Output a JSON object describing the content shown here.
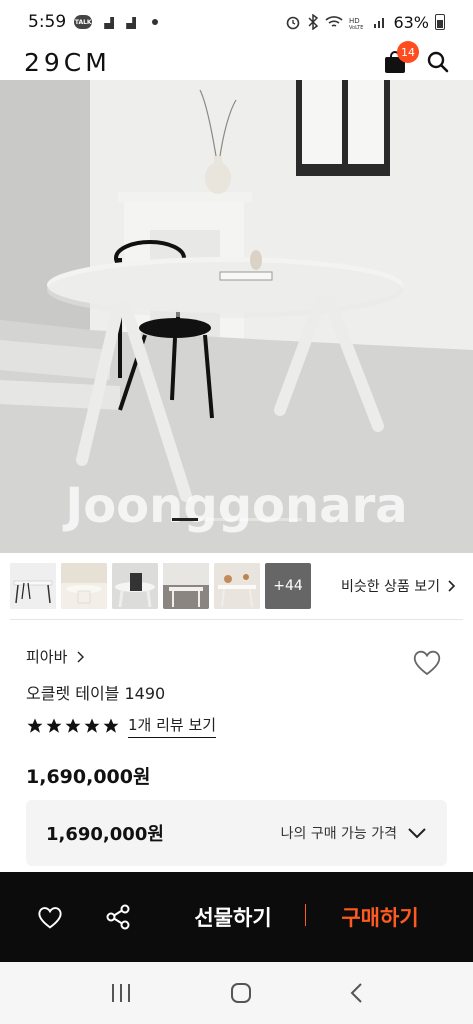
{
  "status_bar": {
    "time": "5:59",
    "battery_percent": "63%"
  },
  "header": {
    "logo": "29CM",
    "cart_badge": "14"
  },
  "hero": {
    "watermark": "Joonggonara",
    "pager": {
      "current": 1,
      "total": 5
    }
  },
  "thumbnails": {
    "more_label": "+44",
    "similar_link": "비슷한 상품 보기"
  },
  "product": {
    "brand": "피아바",
    "name": "오클렛 테이블 1490",
    "rating_stars": 5,
    "review_link": "1개 리뷰 보기",
    "price": "1,690,000원"
  },
  "price_box": {
    "value": "1,690,000원",
    "label": "나의 구매 가능 가격"
  },
  "bottom_bar": {
    "gift_label": "선물하기",
    "buy_label": "구매하기"
  },
  "colors": {
    "accent": "#ff5a1f",
    "badge": "#ff4b1f",
    "bottom_bar": "#0c0c0c"
  }
}
